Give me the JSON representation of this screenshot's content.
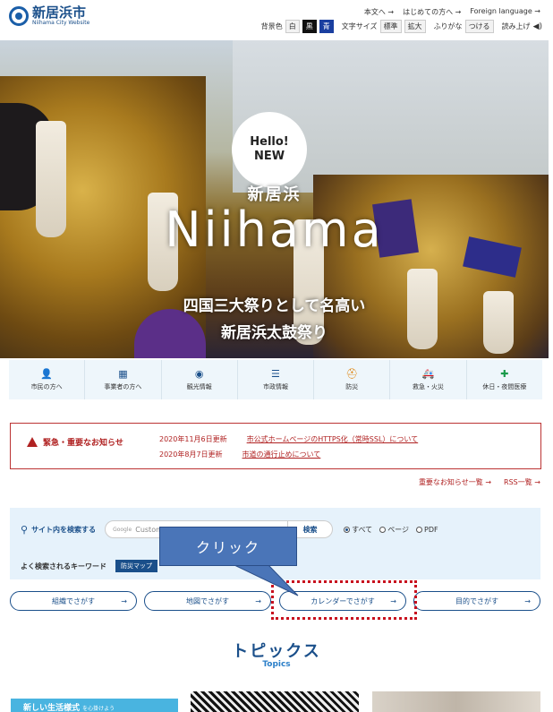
{
  "header": {
    "logo_title": "新居浜市",
    "logo_sub": "Niihama City Website",
    "links": [
      "本文へ",
      "はじめての方へ",
      "Foreign language"
    ],
    "bg_label": "背景色",
    "bg_options": [
      "白",
      "黒",
      "青"
    ],
    "font_label": "文字サイズ",
    "font_options": [
      "標準",
      "拡大"
    ],
    "furigana_label": "ふりがな",
    "furigana_button": "つける",
    "read_aloud": "読み上げ",
    "speaker_glyph": "◀)"
  },
  "hero": {
    "bubble_line1": "Hello!",
    "bubble_line2": "NEW",
    "city": "新居浜",
    "name": "Niihama",
    "line1": "四国三大祭りとして名高い",
    "line2": "新居浜太鼓祭り",
    "pause_glyph": "II"
  },
  "categories": [
    {
      "label": "市民の方へ",
      "icon": "person-icon",
      "glyph": "👤",
      "color": "#1a4f8a"
    },
    {
      "label": "事業者の方へ",
      "icon": "building-icon",
      "glyph": "▦",
      "color": "#1a4f8a"
    },
    {
      "label": "観光情報",
      "icon": "map-pin-icon",
      "glyph": "◉",
      "color": "#1a4f8a"
    },
    {
      "label": "市政情報",
      "icon": "list-icon",
      "glyph": "☰",
      "color": "#1a4f8a"
    },
    {
      "label": "防災",
      "icon": "helmet-icon",
      "glyph": "⛑",
      "color": "#e08a1a"
    },
    {
      "label": "救急・火災",
      "icon": "ambulance-icon",
      "glyph": "🚑",
      "color": "#c8101e"
    },
    {
      "label": "休日・夜間医療",
      "icon": "medical-bag-icon",
      "glyph": "✚",
      "color": "#1a9a4a"
    }
  ],
  "emergency": {
    "title": "緊急・重要なお知らせ",
    "items": [
      {
        "date": "2020年11月6日更新",
        "text": "市公式ホームページのHTTPS化（常時SSL）について"
      },
      {
        "date": "2020年8月7日更新",
        "text": "市道の通行止めについて"
      }
    ],
    "links": [
      "重要なお知らせ一覧",
      "RSS一覧"
    ]
  },
  "search": {
    "label": "サイト内を検索する",
    "google": "Google",
    "placeholder": "Custom S",
    "button": "検索",
    "radios": [
      "すべて",
      "ページ",
      "PDF"
    ],
    "kw_label": "よく検索されるキーワード",
    "kw_tag": "防災マップ"
  },
  "find_buttons": [
    "組織でさがす",
    "地図でさがす",
    "カレンダーでさがす",
    "目的でさがす"
  ],
  "callout": {
    "text": "クリック"
  },
  "topics": {
    "title": "トピックス",
    "sub": "Topics",
    "card1": "新しい生活様式",
    "card1_small": "を心掛けよう"
  }
}
